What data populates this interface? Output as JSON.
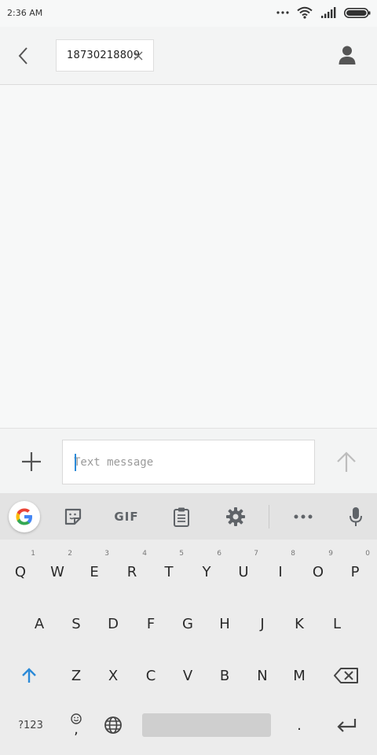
{
  "status_bar": {
    "time": "2:36 AM",
    "icons": [
      "more-dots-icon",
      "wifi-icon",
      "signal-icon",
      "battery-icon"
    ]
  },
  "header": {
    "back_icon": "back-arrow-icon",
    "recipient": "18730218809",
    "chip_close_icon": "close-icon",
    "contact_icon": "person-icon"
  },
  "compose": {
    "attach_icon": "plus-icon",
    "placeholder": "Text message",
    "value": "",
    "send_icon": "send-arrow-icon"
  },
  "keyboard": {
    "toolbar": {
      "google_icon": "google-g-icon",
      "sticker_icon": "sticker-icon",
      "gif_label": "GIF",
      "clipboard_icon": "clipboard-icon",
      "settings_icon": "gear-icon",
      "more_icon": "more-dots-icon",
      "mic_icon": "microphone-icon"
    },
    "row1": [
      "Q",
      "W",
      "E",
      "R",
      "T",
      "Y",
      "U",
      "I",
      "O",
      "P"
    ],
    "row1_hints": [
      "1",
      "2",
      "3",
      "4",
      "5",
      "6",
      "7",
      "8",
      "9",
      "0"
    ],
    "row2": [
      "A",
      "S",
      "D",
      "F",
      "G",
      "H",
      "J",
      "K",
      "L"
    ],
    "row3": [
      "Z",
      "X",
      "C",
      "V",
      "B",
      "N",
      "M"
    ],
    "symbols_label": "?123",
    "comma_label": ",",
    "period_label": ".",
    "accent": "#2b8ad8"
  }
}
